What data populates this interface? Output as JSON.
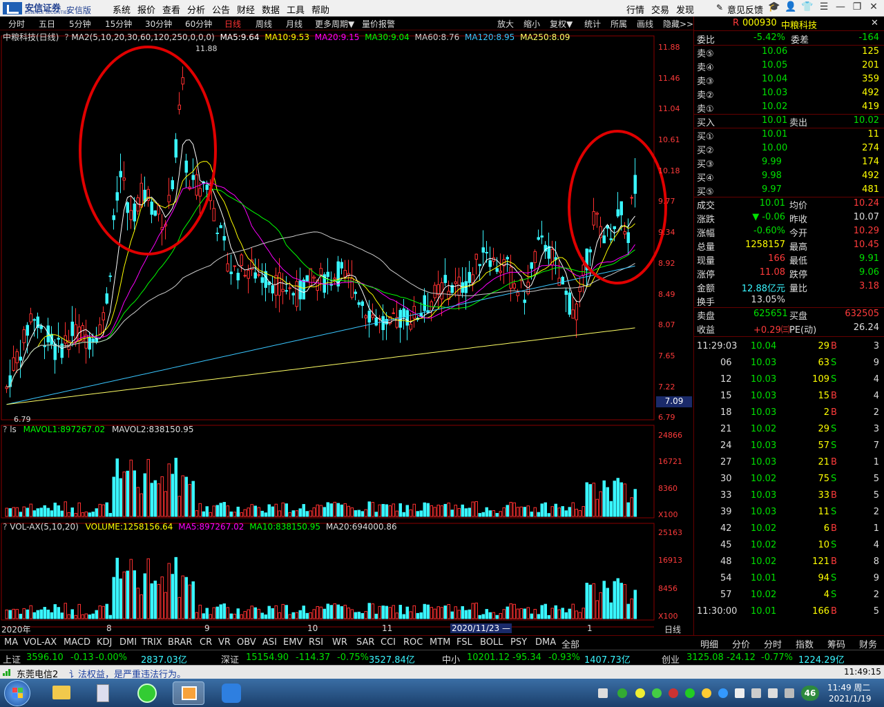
{
  "app": {
    "brand": "安信证券",
    "brand_sub": "ESSENCE SECURITIES",
    "edition": "安信版",
    "menu": [
      "系统",
      "报价",
      "查看",
      "分析",
      "公告",
      "财经",
      "数据",
      "工具",
      "帮助"
    ],
    "right_menu": [
      "行情",
      "交易",
      "发现"
    ],
    "feedback": "意见反馈"
  },
  "toolbar": {
    "periods": [
      "分时",
      "五日",
      "5分钟",
      "15分钟",
      "30分钟",
      "60分钟",
      "日线",
      "周线",
      "月线",
      "更多周期▼",
      "量价报警"
    ],
    "active_period": "日线",
    "actions": [
      "放大",
      "缩小",
      "复权▼",
      "统计",
      "所属",
      "画线",
      "隐藏>>"
    ]
  },
  "main_chart": {
    "legend_title": "中粮科技(日线)",
    "ma_formula": "MA2(5,10,20,30,60,120,250,0,0,0)",
    "ma_items": [
      {
        "label": "MA5:9.64",
        "color": "#ffffff"
      },
      {
        "label": "MA10:9.53",
        "color": "#ffff00"
      },
      {
        "label": "MA20:9.15",
        "color": "#ff00ff"
      },
      {
        "label": "MA30:9.04",
        "color": "#00ff00"
      },
      {
        "label": "MA60:8.76",
        "color": "#cccccc"
      },
      {
        "label": "MA120:8.95",
        "color": "#39c6ff"
      },
      {
        "label": "MA250:8.09",
        "color": "#ffff66"
      }
    ],
    "max_label": "11.88",
    "min_label": "6.79",
    "current_price_tag": "7.09",
    "y_ticks": [
      "11.88",
      "11.46",
      "11.04",
      "10.61",
      "10.18",
      "9.77",
      "9.34",
      "8.92",
      "8.49",
      "8.07",
      "7.65",
      "7.22",
      "6.79"
    ]
  },
  "volume_panel": {
    "title": "ls",
    "items": [
      {
        "label": "MAVOL1:897267.02",
        "color": "#00ff00"
      },
      {
        "label": "MAVOL2:838150.95",
        "color": "#dddddd"
      }
    ],
    "y_ticks": [
      "24866",
      "16721",
      "8360",
      "X100"
    ]
  },
  "volax_panel": {
    "title": "VOL-AX(5,10,20)",
    "items": [
      {
        "label": "VOLUME:1258156.64",
        "color": "#ffff00"
      },
      {
        "label": "MA5:897267.02",
        "color": "#ff00ff"
      },
      {
        "label": "MA10:838150.95",
        "color": "#00ff00"
      },
      {
        "label": "MA20:694000.86",
        "color": "#dddddd"
      }
    ],
    "y_ticks": [
      "25163",
      "16913",
      "8456",
      "X100"
    ]
  },
  "x_axis": {
    "labels": [
      "2020年",
      "8",
      "9",
      "10",
      "11",
      "2020/11/23 —",
      "1"
    ],
    "right_label": "日线"
  },
  "indicator_tabs": [
    "MA",
    "VOL-AX",
    "MACD",
    "KDJ",
    "DMI",
    "TRIX",
    "BRAR",
    "CR",
    "VR",
    "OBV",
    "ASI",
    "EMV",
    "RSI",
    "WR",
    "SAR",
    "CCI",
    "ROC",
    "MTM",
    "FSL",
    "BOLL",
    "PSY",
    "DMA",
    "全部"
  ],
  "active_indicator": "VOL-AX",
  "quote": {
    "code_prefix": "R",
    "code": "000930",
    "name": "中粮科技",
    "weibi_label": "委比",
    "weibi": "-5.42%",
    "weicha_label": "委差",
    "weicha": "-164",
    "sells": [
      {
        "label": "卖⑤",
        "price": "10.06",
        "vol": "125"
      },
      {
        "label": "卖④",
        "price": "10.05",
        "vol": "201"
      },
      {
        "label": "卖③",
        "price": "10.04",
        "vol": "359"
      },
      {
        "label": "卖②",
        "price": "10.03",
        "vol": "492"
      },
      {
        "label": "卖①",
        "price": "10.02",
        "vol": "419"
      }
    ],
    "buy_in_label": "买入",
    "buy_in": "10.01",
    "sell_out_label": "卖出",
    "sell_out": "10.02",
    "buys": [
      {
        "label": "买①",
        "price": "10.01",
        "vol": "11"
      },
      {
        "label": "买②",
        "price": "10.00",
        "vol": "274"
      },
      {
        "label": "买③",
        "price": "9.99",
        "vol": "174"
      },
      {
        "label": "买④",
        "price": "9.98",
        "vol": "492"
      },
      {
        "label": "买⑤",
        "price": "9.97",
        "vol": "481"
      }
    ],
    "stats": [
      {
        "l1": "成交",
        "v1": "10.01",
        "c1": "green",
        "l2": "均价",
        "v2": "10.24",
        "c2": "red"
      },
      {
        "l1": "涨跌",
        "v1": "▼ -0.06",
        "c1": "green",
        "l2": "昨收",
        "v2": "10.07",
        "c2": "white"
      },
      {
        "l1": "涨幅",
        "v1": "-0.60%",
        "c1": "green",
        "l2": "今开",
        "v2": "10.29",
        "c2": "red"
      },
      {
        "l1": "总量",
        "v1": "1258157",
        "c1": "yellow",
        "l2": "最高",
        "v2": "10.45",
        "c2": "red"
      },
      {
        "l1": "现量",
        "v1": "166",
        "c1": "red",
        "l2": "最低",
        "v2": "9.91",
        "c2": "green"
      },
      {
        "l1": "涨停",
        "v1": "11.08",
        "c1": "red",
        "l2": "跌停",
        "v2": "9.06",
        "c2": "green"
      },
      {
        "l1": "金额",
        "v1": "12.88亿元",
        "c1": "cyan",
        "l2": "量比",
        "v2": "3.18",
        "c2": "red"
      },
      {
        "l1": "换手",
        "v1": "13.05%",
        "c1": "white",
        "l2": "",
        "v2": "",
        "c2": "white"
      }
    ],
    "waipan_label": "卖盘",
    "waipan": "625651",
    "neipan_label": "买盘",
    "neipan": "632505",
    "shouyi_label": "收益",
    "shouyi": "+0.29㈢",
    "pe_label": "PE(动)",
    "pe": "26.24"
  },
  "ticks": [
    {
      "time": "11:29:03",
      "price": "10.04",
      "vol": "29",
      "side": "B",
      "n": "3"
    },
    {
      "time": "06",
      "price": "10.03",
      "vol": "63",
      "side": "S",
      "n": "9"
    },
    {
      "time": "12",
      "price": "10.03",
      "vol": "109",
      "side": "S",
      "n": "4"
    },
    {
      "time": "15",
      "price": "10.03",
      "vol": "15",
      "side": "B",
      "n": "4"
    },
    {
      "time": "18",
      "price": "10.03",
      "vol": "2",
      "side": "B",
      "n": "2"
    },
    {
      "time": "21",
      "price": "10.02",
      "vol": "29",
      "side": "S",
      "n": "3"
    },
    {
      "time": "24",
      "price": "10.03",
      "vol": "57",
      "side": "S",
      "n": "7"
    },
    {
      "time": "27",
      "price": "10.03",
      "vol": "21",
      "side": "B",
      "n": "1"
    },
    {
      "time": "30",
      "price": "10.02",
      "vol": "75",
      "side": "S",
      "n": "5"
    },
    {
      "time": "33",
      "price": "10.03",
      "vol": "33",
      "side": "B",
      "n": "5"
    },
    {
      "time": "39",
      "price": "10.03",
      "vol": "11",
      "side": "S",
      "n": "2"
    },
    {
      "time": "42",
      "price": "10.02",
      "vol": "6",
      "side": "B",
      "n": "1"
    },
    {
      "time": "45",
      "price": "10.02",
      "vol": "10",
      "side": "S",
      "n": "4"
    },
    {
      "time": "48",
      "price": "10.02",
      "vol": "121",
      "side": "B",
      "n": "8"
    },
    {
      "time": "54",
      "price": "10.01",
      "vol": "94",
      "side": "S",
      "n": "9"
    },
    {
      "time": "57",
      "price": "10.02",
      "vol": "4",
      "side": "S",
      "n": "2"
    },
    {
      "time": "11:30:00",
      "price": "10.01",
      "vol": "166",
      "side": "B",
      "n": "5"
    }
  ],
  "right_tabs": [
    "明细",
    "分价",
    "分时",
    "指数",
    "筹码",
    "财务"
  ],
  "active_right_tab": "明细",
  "index_bar": [
    {
      "name": "上证",
      "value": "3596.10",
      "chg": "-0.13",
      "pct": "-0.00%",
      "amt": "2837.03亿"
    },
    {
      "name": "深证",
      "value": "15154.90",
      "chg": "-114.37",
      "pct": "-0.75%",
      "amt": "3527.84亿"
    },
    {
      "name": "中小",
      "value": "10201.12",
      "chg": "-95.34",
      "pct": "-0.93%",
      "amt": "1407.73亿"
    },
    {
      "name": "创业",
      "value": "3125.08",
      "chg": "-24.12",
      "pct": "-0.77%",
      "amt": "1224.29亿"
    }
  ],
  "status": {
    "connection": "东莞电信2",
    "message": "讠法权益，是严重违法行为。",
    "time": "11:49:15"
  },
  "taskbar": {
    "clock_time": "11:49 周二",
    "clock_date": "2021/1/19",
    "badge": "46"
  }
}
